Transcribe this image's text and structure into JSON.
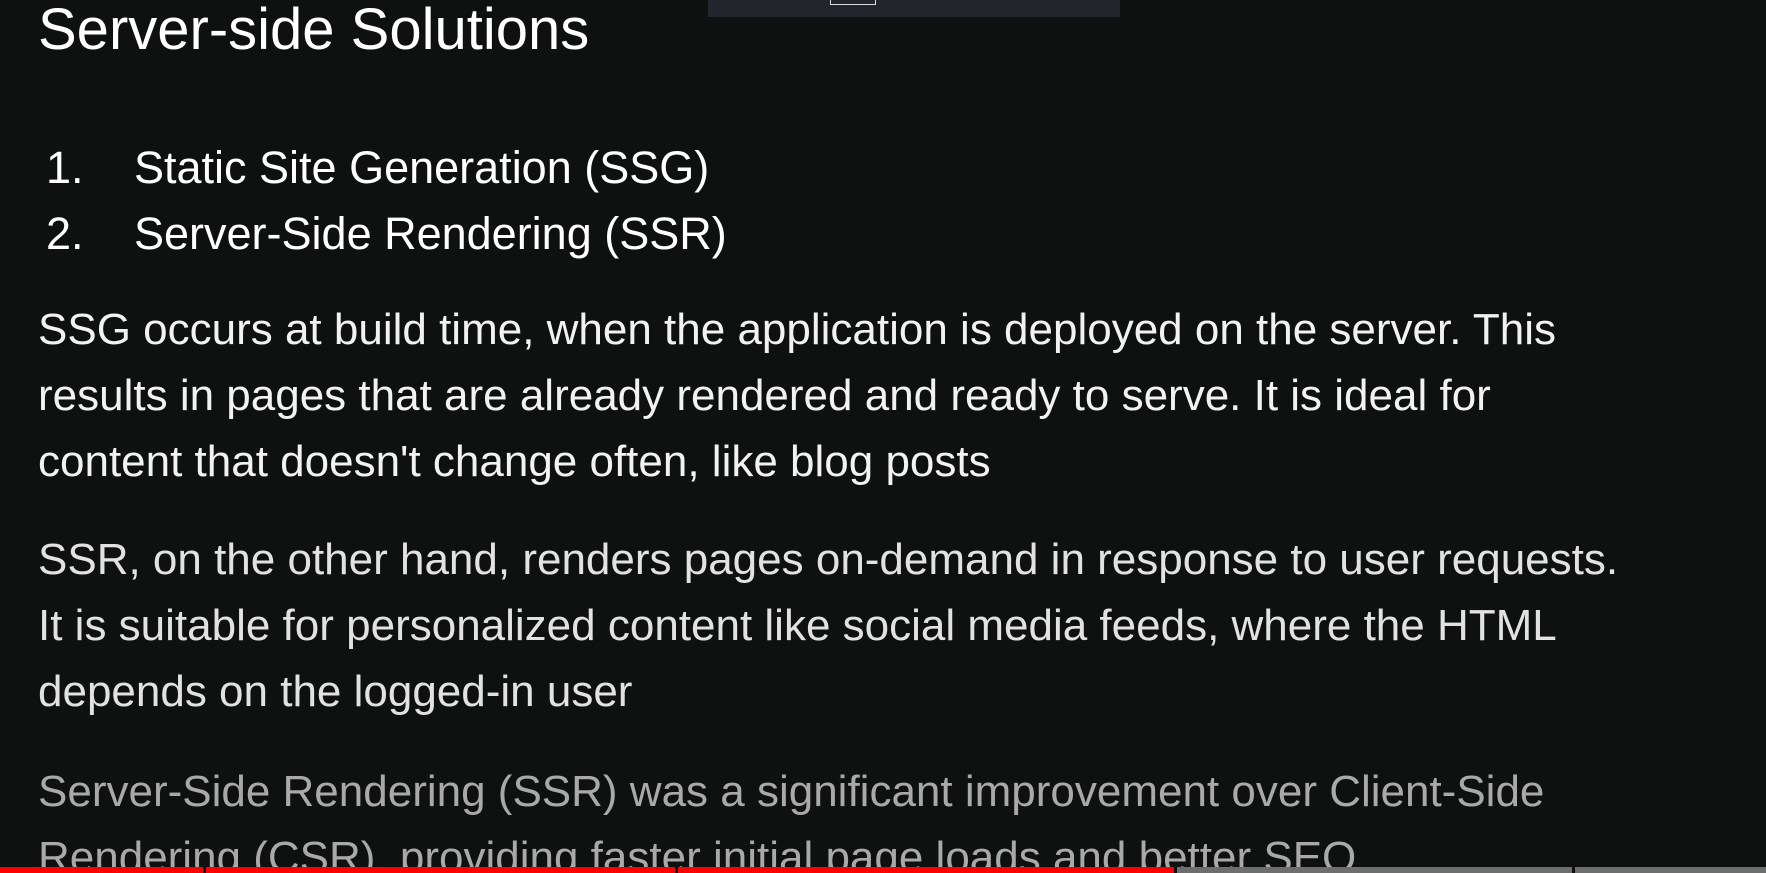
{
  "slide": {
    "title": "Server-side Solutions",
    "list": [
      {
        "number": "1.",
        "text": "Static Site Generation (SSG)"
      },
      {
        "number": "2.",
        "text": "Server-Side Rendering (SSR)"
      }
    ],
    "paragraphs": [
      {
        "lines": [
          "SSG occurs at build time, when the application is deployed on the server. This",
          "results in pages that are already rendered and ready to serve. It is ideal for",
          "content that doesn't change often, like blog posts"
        ]
      },
      {
        "lines": [
          "SSR, on the other hand, renders pages on-demand in response to user requests.",
          "It is suitable for personalized content like social media feeds, where the HTML",
          "depends on the logged-in user"
        ]
      },
      {
        "lines": [
          "Server-Side Rendering (SSR) was a significant improvement over Client-Side",
          "Rendering (CSR), providing faster initial page loads and better SEO."
        ]
      }
    ]
  },
  "video_progress": {
    "played_fraction": 0.665,
    "played_color": "#ff0000",
    "unplayed_color": "#6e6e6e"
  }
}
